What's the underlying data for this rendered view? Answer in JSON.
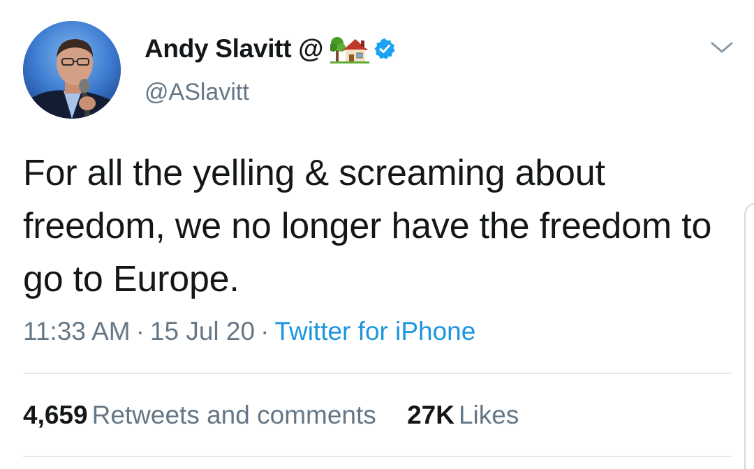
{
  "tweet": {
    "author": {
      "display_name": "Andy Slavitt @",
      "name_emoji": "tree-house-emoji",
      "verified_icon": "verified-badge-icon",
      "handle": "@ASlavitt"
    },
    "text": "For all the yelling & screaming about freedom, we no longer have the freedom to go to Europe.",
    "time": "11:33 AM",
    "separator": "·",
    "date": "15 Jul 20",
    "source": "Twitter for iPhone",
    "stats": {
      "retweets_count": "4,659",
      "retweets_label": "Retweets and comments",
      "likes_count": "27K",
      "likes_label": "Likes"
    }
  },
  "colors": {
    "text_primary": "#14171a",
    "text_secondary": "#657786",
    "link": "#1b95e0",
    "verified": "#1da1f2",
    "divider": "#e1e8ed"
  }
}
